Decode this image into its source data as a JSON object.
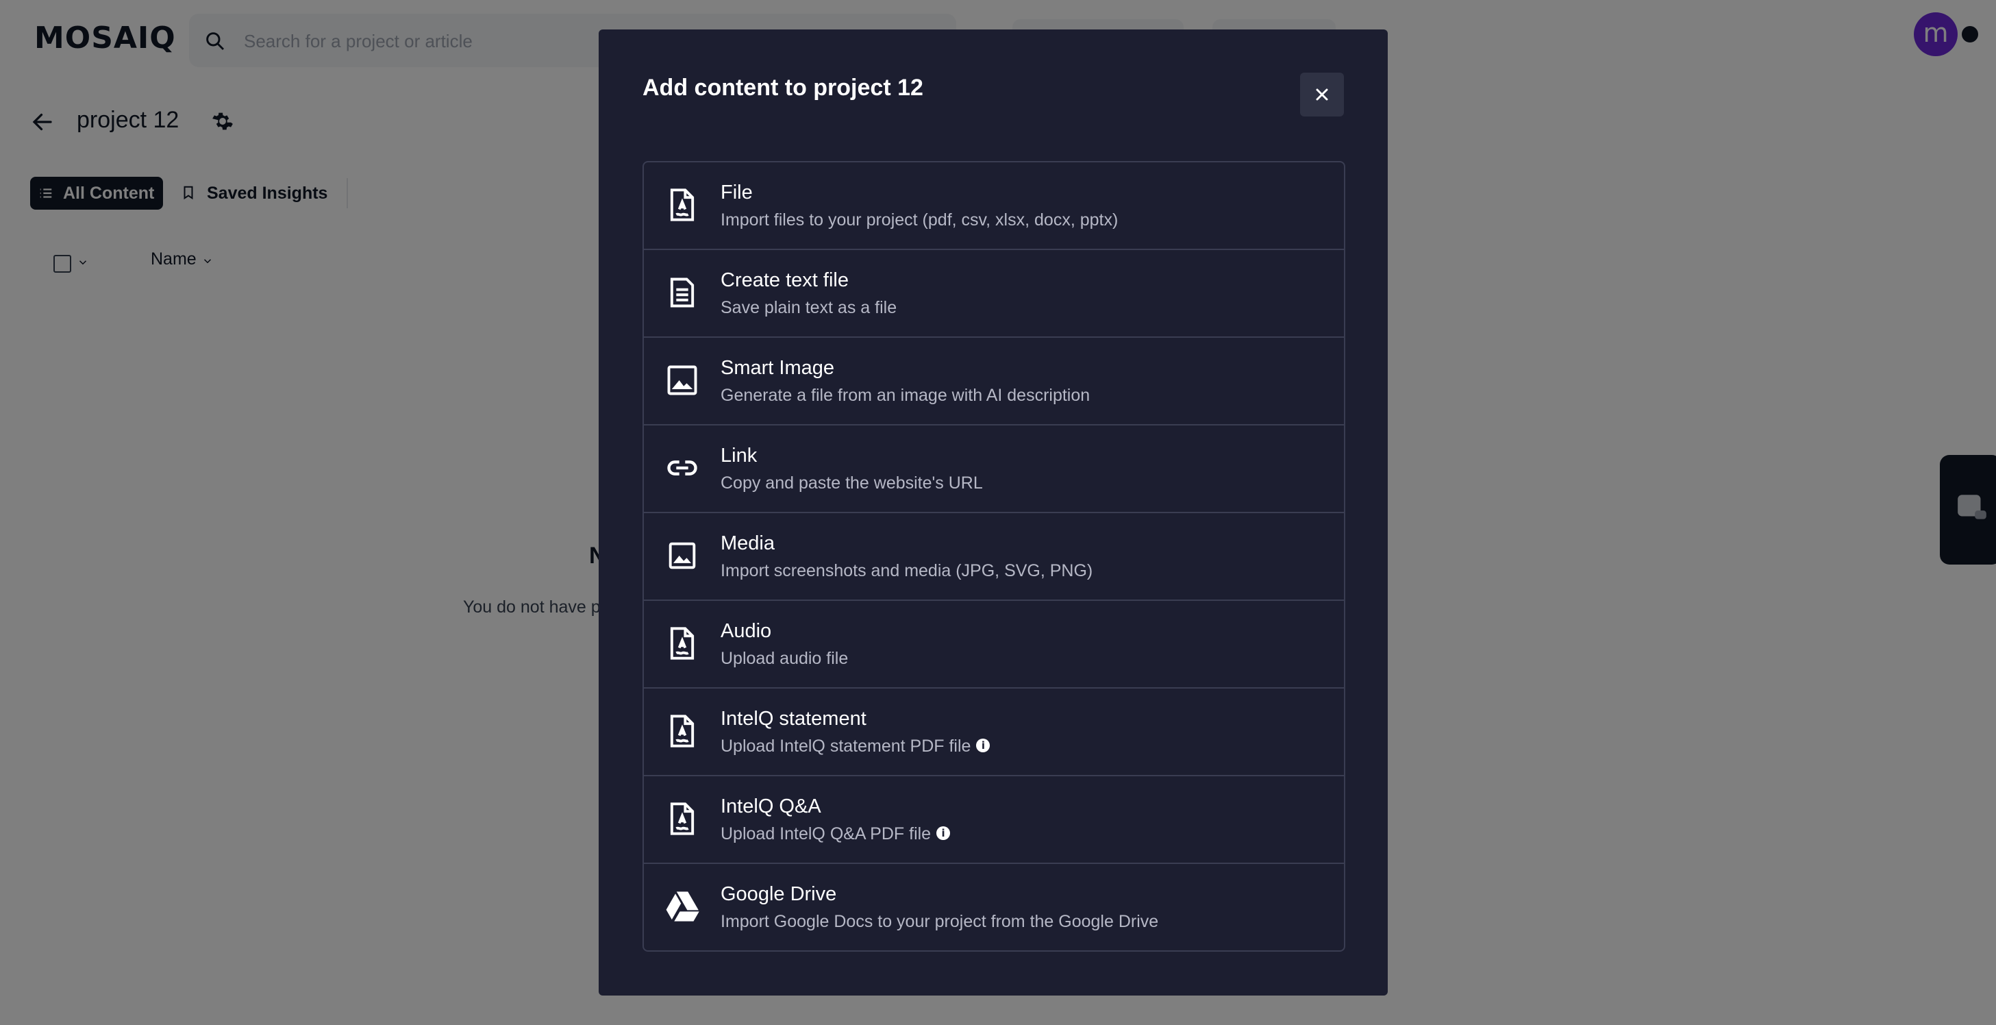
{
  "app": {
    "logo": "MOSAIQ",
    "search_placeholder": "Search for a project or article",
    "avatar_initial": "m"
  },
  "project": {
    "title": "project 12"
  },
  "tabs": [
    {
      "label": "All Content",
      "icon": "list-icon",
      "active": true
    },
    {
      "label": "Saved Insights",
      "icon": "bookmark-icon",
      "active": false
    }
  ],
  "table": {
    "column_name": "Name"
  },
  "empty_state": {
    "title": "N",
    "text": "You do not have p"
  },
  "modal": {
    "title": "Add content to project 12",
    "close_icon": "close-icon",
    "options": [
      {
        "title": "File",
        "description": "Import files to your project (pdf, csv, xlsx, docx, pptx)",
        "icon": "file-document-icon",
        "info": false
      },
      {
        "title": "Create text file",
        "description": "Save plain text as a file",
        "icon": "text-file-icon",
        "info": false
      },
      {
        "title": "Smart Image",
        "description": "Generate a file from an image with AI description",
        "icon": "image-icon",
        "info": false
      },
      {
        "title": "Link",
        "description": "Copy and paste the website's URL",
        "icon": "link-icon",
        "info": false
      },
      {
        "title": "Media",
        "description": "Import screenshots and media (JPG, SVG, PNG)",
        "icon": "media-icon",
        "info": false
      },
      {
        "title": "Audio",
        "description": "Upload audio file",
        "icon": "audio-file-icon",
        "info": false
      },
      {
        "title": "IntelQ statement",
        "description": "Upload IntelQ statement PDF file",
        "icon": "statement-file-icon",
        "info": true
      },
      {
        "title": "IntelQ Q&A",
        "description": "Upload IntelQ Q&A PDF file",
        "icon": "qa-file-icon",
        "info": true
      },
      {
        "title": "Google Drive",
        "description": "Import Google Docs to your project from the Google Drive",
        "icon": "google-drive-icon",
        "info": false
      }
    ]
  },
  "colors": {
    "modal_bg": "#1c1e30",
    "overlay": "rgba(0,0,0,0.5)",
    "accent_avatar": "#6d28d9",
    "dark": "#111827"
  }
}
